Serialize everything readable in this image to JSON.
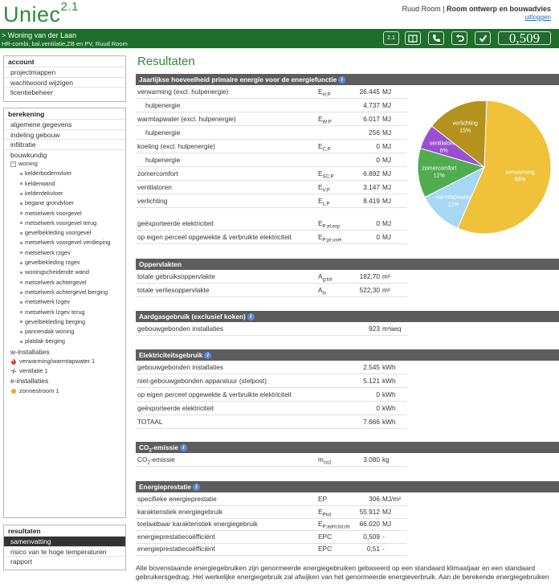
{
  "app": {
    "logo_text": "Uniec",
    "logo_version": "2.1",
    "user_name": "Ruud Room",
    "company": "Room ontwerp en bouwadvies",
    "logout": "uitloggen"
  },
  "project": {
    "title": "> Woning van der Laan",
    "subtitle": "HR-combi, bal.ventilatie,ZB en PV, Ruud Room",
    "score": "0,509",
    "toolbar_icons": [
      "version-2-1-icon",
      "book-icon",
      "phone-icon",
      "undo-icon",
      "checkmark-icon"
    ],
    "toolbar_label_first": "2.1"
  },
  "sidebar": {
    "account": {
      "title": "account",
      "items": [
        "projectmappen",
        "wachtwoord wijzigen",
        "licentiebeheer"
      ]
    },
    "berekening": {
      "title": "berekening",
      "items": [
        "algemene gegevens",
        "indeling gebouw",
        "infiltratie",
        "bouwkundig"
      ],
      "tree_root": "woning",
      "tree_items": [
        "kelderbodemvloer",
        "kelderwand",
        "kelderdekvloer",
        "begane grondvloer",
        "metselwerk voorgevel",
        "metselwerk voorgevel terug",
        "gevelbekleding voorgevel",
        "metselwerk voorgevel verdieping",
        "metselwerk rzgev",
        "gevelbekleding rzgev",
        "woningscheidende wand",
        "metselwerk achtergevel",
        "metselwerk achtergevel berging",
        "metselwerk lzgev",
        "metselwerk lzgev terug",
        "gevelbekleding berging",
        "pannendak woning",
        "platdak berging"
      ],
      "w_installaties": "w-installaties",
      "w_items": [
        "verwarming/warmtapwater 1",
        "ventilatie 1"
      ],
      "e_installaties": "e-installaties",
      "e_items": [
        "zonnestroom 1"
      ]
    },
    "resultaten": {
      "title": "resultaten",
      "items": [
        "samenvatting",
        "risico van te hoge temperaturen",
        "rapport"
      ],
      "selected": "samenvatting"
    }
  },
  "content": {
    "page_title": "Resultaten",
    "primary": {
      "header": "Jaarlijkse hoeveelheid primaire energie voor de energiefunctie",
      "rows": [
        {
          "label": "verwarming (excl. hulpenergie)",
          "sym": "E",
          "sub": "H;P",
          "value": "26.445",
          "unit": "MJ",
          "indent": false
        },
        {
          "label": "hulpenergie",
          "sym": "",
          "sub": "",
          "value": "4.737",
          "unit": "MJ",
          "indent": true
        },
        {
          "label": "warmtapwater (excl. hulpenergie)",
          "sym": "E",
          "sub": "W;P",
          "value": "6.017",
          "unit": "MJ",
          "indent": false
        },
        {
          "label": "hulpenergie",
          "sym": "",
          "sub": "",
          "value": "256",
          "unit": "MJ",
          "indent": true
        },
        {
          "label": "koeling (excl. hulpenergie)",
          "sym": "E",
          "sub": "C;P",
          "value": "0",
          "unit": "MJ",
          "indent": false
        },
        {
          "label": "hulpenergie",
          "sym": "",
          "sub": "",
          "value": "0",
          "unit": "MJ",
          "indent": true
        },
        {
          "label": "zomercomfort",
          "sym": "E",
          "sub": "SC;P",
          "value": "6.892",
          "unit": "MJ",
          "indent": false
        },
        {
          "label": "ventilatoren",
          "sym": "E",
          "sub": "V;P",
          "value": "3.147",
          "unit": "MJ",
          "indent": false
        },
        {
          "label": "verlichting",
          "sym": "E",
          "sub": "L;P",
          "value": "8.419",
          "unit": "MJ",
          "indent": false
        }
      ],
      "rows2": [
        {
          "label": "geëxporteerde elektriciteit",
          "sym": "E",
          "sub": "P;el;exp",
          "value": "0",
          "unit": "MJ"
        },
        {
          "label": "op eigen perceel opgewekte & verbruikte elektriciteit",
          "sym": "E",
          "sub": "P;pr;usel",
          "value": "0",
          "unit": "MJ"
        }
      ]
    },
    "oppervlakten": {
      "header": "Oppervlakten",
      "rows": [
        {
          "label": "totale gebruiksoppervlakte",
          "sym": "A",
          "sub": "g;tot",
          "value": "182,70",
          "unit": "m²"
        },
        {
          "label": "totale verliesoppervlakte",
          "sym": "A",
          "sub": "ls",
          "value": "522,30",
          "unit": "m²"
        }
      ]
    },
    "aardgas": {
      "header": "Aardgasgebruik (exclusief koken)",
      "rows": [
        {
          "label": "gebouwgebonden installaties",
          "value": "923",
          "unit": "m³aeq"
        }
      ]
    },
    "elektriciteit": {
      "header": "Elektriciteitsgebruik",
      "rows": [
        {
          "label": "gebouwgebonden installaties",
          "value": "2.545",
          "unit": "kWh"
        },
        {
          "label": "niet-gebouwgebonden apparatuur (stelpost)",
          "value": "5.121",
          "unit": "kWh"
        },
        {
          "label": "op eigen perceel opgewekte & verbruikte elektriciteit",
          "value": "0",
          "unit": "kWh"
        },
        {
          "label": "geëxporteerde elektriciteit",
          "value": "0",
          "unit": "kWh"
        },
        {
          "label": "TOTAAL",
          "value": "7.666",
          "unit": "kWh"
        }
      ]
    },
    "co2": {
      "header_pre": "CO",
      "header_sub": "2",
      "header_post": "-emissie",
      "rows": [
        {
          "label_pre": "CO",
          "label_sub": "2",
          "label_post": "-emissie",
          "sym": "m",
          "sub": "co2",
          "value": "3.080",
          "unit": "kg"
        }
      ]
    },
    "ep": {
      "header": "Energieprestatie",
      "rows": [
        {
          "label": "specifieke energieprestatie",
          "sym": "EP",
          "sub": "",
          "value": "306",
          "unit": "MJ/m²"
        },
        {
          "label": "karakteristiek energiegebruik",
          "sym": "E",
          "sub": "Ptot",
          "value": "55.912",
          "unit": "MJ"
        },
        {
          "label": "toelaatbaar karakteristiek energiegebruik",
          "sym": "E",
          "sub": "P;adm;tot;nb",
          "value": "66.020",
          "unit": "MJ"
        },
        {
          "label": "energieprestatiecoëfficiënt",
          "sym": "EPC",
          "sub": "",
          "value": "0,509",
          "unit": "-"
        },
        {
          "label": "energieprestatiecoëfficiënt",
          "sym": "EPC",
          "sub": "",
          "value": "0,51",
          "unit": "-"
        }
      ]
    },
    "footer": "Alle bovenstaande energiegebruiken zijn genormeerde energiegebruiken gebaseerd op een standaard klimaatjaar en een standaard gebruikersgedrag. Het werkelijke energiegebruik zal afwijken van het genormeerde energieverbruik. Aan de berekende energiegebruiken"
  },
  "chart_data": {
    "type": "pie",
    "categories": [
      "verwarming",
      "warmtapwater",
      "zomercomfort",
      "ventilatoren",
      "verlichting"
    ],
    "values": [
      56,
      11,
      12,
      6,
      15
    ],
    "labels": [
      "verwarming 56%",
      "warmtapwater 11%",
      "zomercomfort 12%",
      "ventilatoren 6%",
      "verlichting 15%"
    ],
    "colors": [
      "#efc23a",
      "#a6d8f3",
      "#4fad4f",
      "#9a4fd3",
      "#b3921e"
    ]
  }
}
